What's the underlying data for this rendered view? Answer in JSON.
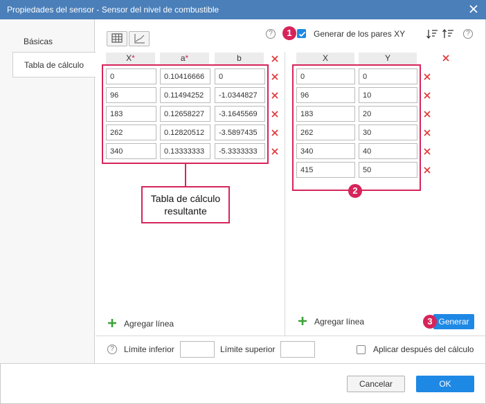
{
  "window": {
    "title": "Propiedades del sensor - Sensor del nivel de combustible",
    "close_icon": "close-icon"
  },
  "tabs": [
    {
      "label": "Básicas",
      "active": false
    },
    {
      "label": "Tabla de cálculo",
      "active": true
    }
  ],
  "left_table": {
    "view_buttons": [
      "table-icon",
      "chart-icon"
    ],
    "columns": [
      {
        "label": "X",
        "required": "*"
      },
      {
        "label": "a",
        "required": "*"
      },
      {
        "label": "b",
        "required": ""
      }
    ],
    "rows": [
      [
        "0",
        "0.10416666",
        "0"
      ],
      [
        "96",
        "0.11494252",
        "-1.0344827"
      ],
      [
        "183",
        "0.12658227",
        "-3.1645569"
      ],
      [
        "262",
        "0.12820512",
        "-3.5897435"
      ],
      [
        "340",
        "0.13333333",
        "-5.3333333"
      ]
    ],
    "add_line_label": "Agregar línea",
    "callout": [
      "Tabla de cálculo",
      "resultante"
    ]
  },
  "right_table": {
    "generate_checkbox_label": "Generar de los pares XY",
    "generate_checked": true,
    "columns": [
      "X",
      "Y"
    ],
    "rows": [
      [
        "0",
        "0"
      ],
      [
        "96",
        "10"
      ],
      [
        "183",
        "20"
      ],
      [
        "262",
        "30"
      ],
      [
        "340",
        "40"
      ],
      [
        "415",
        "50"
      ]
    ],
    "add_line_label": "Agregar línea",
    "generate_button": "Generar"
  },
  "markers": [
    "1",
    "2",
    "3"
  ],
  "bottom": {
    "lower_limit_label": "Límite inferior",
    "lower_limit_value": "",
    "upper_limit_label": "Límite superior",
    "upper_limit_value": "",
    "apply_after_label": "Aplicar después del cálculo",
    "apply_after_checked": false
  },
  "footer": {
    "cancel_label": "Cancelar",
    "ok_label": "OK"
  },
  "colors": {
    "titlebar": "#4a7fb9",
    "accent": "#1e88e5",
    "highlight": "#d6245a",
    "delete": "#e03c3c",
    "add": "#3aa336"
  }
}
